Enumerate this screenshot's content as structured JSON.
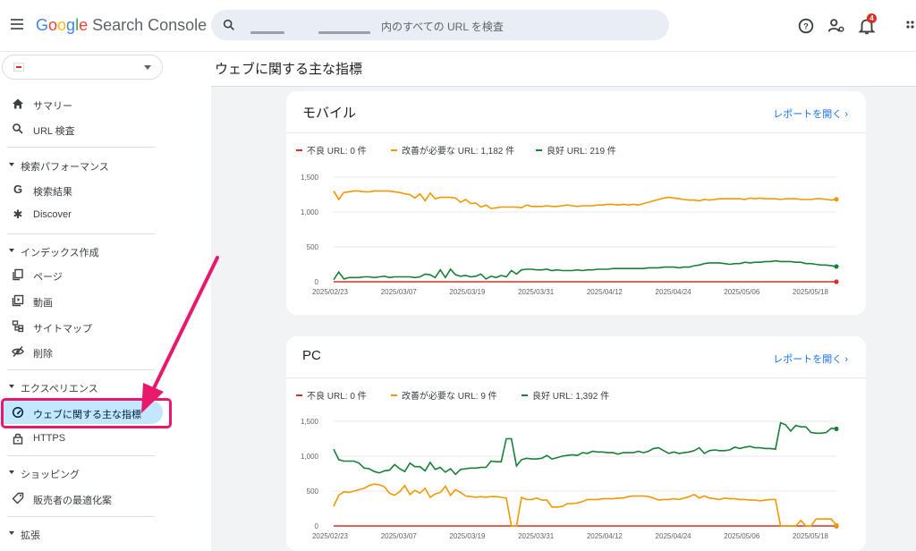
{
  "app": {
    "brand": {
      "g1": "G",
      "g2": "o",
      "g3": "o",
      "g4": "g",
      "g5": "l",
      "g6": "e",
      "product": "Search Console"
    },
    "search_placeholder": "内のすべての URL を検査",
    "notification_count": "4"
  },
  "sidebar": {
    "items": [
      {
        "label": "サマリー",
        "icon": "home-icon"
      },
      {
        "label": "URL 検査",
        "icon": "search-icon"
      },
      {
        "label": "検索パフォーマンス",
        "section": true
      },
      {
        "label": "検索結果",
        "icon": "google-g-icon"
      },
      {
        "label": "Discover",
        "icon": "asterisk-icon"
      },
      {
        "label": "インデックス作成",
        "section": true
      },
      {
        "label": "ページ",
        "icon": "pages-icon"
      },
      {
        "label": "動画",
        "icon": "video-icon"
      },
      {
        "label": "サイトマップ",
        "icon": "sitemap-icon"
      },
      {
        "label": "削除",
        "icon": "removal-icon"
      },
      {
        "label": "エクスペリエンス",
        "section": true
      },
      {
        "label": "ウェブに関する主な指標",
        "icon": "gauge-icon",
        "active": true
      },
      {
        "label": "HTTPS",
        "icon": "lock-icon"
      },
      {
        "label": "ショッピング",
        "section": true
      },
      {
        "label": "販売者の最適化案",
        "icon": "tag-icon"
      },
      {
        "label": "拡張",
        "section": true
      }
    ]
  },
  "main": {
    "title": "ウェブに関する主な指標",
    "report_link": "レポートを開く"
  },
  "colors": {
    "poor": "#d93025",
    "needs": "#f29900",
    "good": "#188038",
    "accent": "#1a73e8",
    "annotation": "#e8196b"
  },
  "chart_data": [
    {
      "type": "line",
      "title": "モバイル",
      "x": [
        "2025/02/23",
        "2025/03/07",
        "2025/03/19",
        "2025/03/31",
        "2025/04/12",
        "2025/04/24",
        "2025/05/06",
        "2025/05/18"
      ],
      "ylim": [
        0,
        1500
      ],
      "yticks": [
        "1,500",
        "1,000",
        "500",
        "0"
      ],
      "series": [
        {
          "name": "不良 URL: 0 件",
          "key": "poor",
          "values": [
            0,
            0,
            0,
            0,
            0,
            0,
            0,
            0,
            0,
            0,
            0,
            0,
            0,
            0,
            0,
            0,
            0,
            0,
            0,
            0,
            0,
            0,
            0,
            0,
            0,
            0,
            0,
            0,
            0,
            0,
            0,
            0,
            0,
            0,
            0,
            0,
            0,
            0,
            0,
            0,
            0,
            0,
            0,
            0,
            0,
            0,
            0,
            0,
            0,
            0,
            0,
            0,
            0,
            0,
            0,
            0,
            0,
            0,
            0,
            0,
            0,
            0,
            0,
            0,
            0,
            0,
            0,
            0,
            0,
            0,
            0,
            0,
            0,
            0,
            0,
            0,
            0,
            0,
            0,
            0,
            0,
            0,
            0,
            0,
            0,
            0,
            0,
            0,
            0,
            0,
            0,
            0,
            0,
            0,
            0,
            0,
            0,
            0,
            0,
            0
          ]
        },
        {
          "name": "改善が必要な URL: 1,182 件",
          "key": "needs",
          "values": [
            1300,
            1180,
            1280,
            1290,
            1300,
            1300,
            1290,
            1290,
            1300,
            1300,
            1300,
            1300,
            1290,
            1280,
            1260,
            1250,
            1200,
            1260,
            1160,
            1270,
            1190,
            1210,
            1210,
            1210,
            1200,
            1140,
            1180,
            1120,
            1130,
            1070,
            1100,
            1050,
            1060,
            1070,
            1070,
            1070,
            1070,
            1060,
            1100,
            1080,
            1080,
            1080,
            1090,
            1080,
            1080,
            1090,
            1100,
            1090,
            1080,
            1090,
            1090,
            1090,
            1100,
            1100,
            1110,
            1110,
            1100,
            1110,
            1100,
            1110,
            1100,
            1120,
            1140,
            1160,
            1180,
            1200,
            1210,
            1200,
            1190,
            1180,
            1170,
            1170,
            1160,
            1180,
            1170,
            1180,
            1190,
            1190,
            1190,
            1190,
            1190,
            1180,
            1200,
            1190,
            1200,
            1190,
            1190,
            1190,
            1180,
            1190,
            1190,
            1190,
            1180,
            1180,
            1180,
            1190,
            1190,
            1180,
            1170,
            1182
          ]
        },
        {
          "name": "良好 URL: 219 件",
          "key": "good",
          "values": [
            30,
            140,
            40,
            60,
            60,
            60,
            70,
            70,
            60,
            70,
            80,
            60,
            70,
            70,
            70,
            70,
            60,
            70,
            110,
            100,
            60,
            170,
            60,
            180,
            100,
            80,
            90,
            70,
            80,
            110,
            40,
            80,
            60,
            90,
            70,
            160,
            110,
            170,
            180,
            180,
            170,
            170,
            180,
            160,
            170,
            160,
            160,
            160,
            170,
            160,
            170,
            170,
            180,
            180,
            180,
            190,
            190,
            190,
            190,
            190,
            190,
            190,
            200,
            200,
            200,
            210,
            210,
            210,
            200,
            210,
            210,
            230,
            240,
            260,
            270,
            270,
            270,
            260,
            250,
            260,
            260,
            280,
            270,
            280,
            280,
            290,
            290,
            300,
            290,
            290,
            290,
            280,
            280,
            260,
            260,
            250,
            240,
            240,
            230,
            219
          ]
        }
      ]
    },
    {
      "type": "line",
      "title": "PC",
      "x": [
        "2025/02/23",
        "2025/03/07",
        "2025/03/19",
        "2025/03/31",
        "2025/04/12",
        "2025/04/24",
        "2025/05/06",
        "2025/05/18"
      ],
      "ylim": [
        0,
        1500
      ],
      "yticks": [
        "1,500",
        "1,000",
        "500",
        "0"
      ],
      "series": [
        {
          "name": "不良 URL: 0 件",
          "key": "poor",
          "values": [
            0,
            0,
            0,
            0,
            0,
            0,
            0,
            0,
            0,
            0,
            0,
            0,
            0,
            0,
            0,
            0,
            0,
            0,
            0,
            0,
            0,
            0,
            0,
            0,
            0,
            0,
            0,
            0,
            0,
            0,
            0,
            0,
            0,
            0,
            0,
            0,
            0,
            0,
            0,
            0,
            0,
            0,
            0,
            0,
            0,
            0,
            0,
            0,
            0,
            0,
            0,
            0,
            0,
            0,
            0,
            0,
            0,
            0,
            0,
            0,
            0,
            0,
            0,
            0,
            0,
            0,
            0,
            0,
            0,
            0,
            0,
            0,
            0,
            0,
            0,
            0,
            0,
            0,
            0,
            0,
            0,
            0,
            0,
            0,
            0,
            0,
            0,
            0,
            0,
            0,
            0,
            0,
            0,
            0,
            0,
            0,
            0,
            0,
            0,
            0
          ]
        },
        {
          "name": "改善が必要な URL: 9 件",
          "key": "needs",
          "values": [
            280,
            440,
            490,
            480,
            500,
            520,
            540,
            580,
            600,
            590,
            560,
            470,
            440,
            490,
            580,
            450,
            510,
            470,
            540,
            410,
            460,
            480,
            570,
            440,
            520,
            480,
            430,
            420,
            410,
            420,
            410,
            420,
            420,
            410,
            400,
            0,
            0,
            410,
            380,
            380,
            400,
            370,
            370,
            270,
            270,
            280,
            320,
            320,
            330,
            350,
            380,
            380,
            380,
            390,
            390,
            390,
            400,
            400,
            420,
            430,
            430,
            430,
            420,
            400,
            370,
            380,
            380,
            390,
            380,
            400,
            420,
            450,
            400,
            430,
            400,
            390,
            380,
            400,
            390,
            390,
            380,
            380,
            370,
            370,
            360,
            370,
            380,
            380,
            0,
            0,
            0,
            0,
            80,
            0,
            0,
            100,
            100,
            100,
            100,
            9
          ]
        },
        {
          "name": "良好 URL: 1,392 件",
          "key": "good",
          "values": [
            1100,
            950,
            930,
            930,
            930,
            900,
            830,
            820,
            780,
            760,
            790,
            800,
            880,
            820,
            780,
            900,
            850,
            850,
            790,
            910,
            810,
            840,
            770,
            820,
            740,
            810,
            820,
            830,
            830,
            840,
            840,
            930,
            920,
            920,
            1250,
            1250,
            860,
            950,
            970,
            960,
            960,
            970,
            1010,
            960,
            980,
            1000,
            1010,
            1020,
            1010,
            1050,
            1040,
            1070,
            1060,
            1060,
            1050,
            1050,
            1030,
            1050,
            1050,
            1050,
            1070,
            1050,
            1070,
            1110,
            1120,
            1080,
            1040,
            1060,
            1040,
            1050,
            1060,
            1080,
            1120,
            1040,
            1080,
            1090,
            1080,
            1080,
            1090,
            1130,
            1110,
            1130,
            1140,
            1120,
            1120,
            1110,
            1110,
            1100,
            1480,
            1450,
            1360,
            1440,
            1420,
            1420,
            1340,
            1330,
            1330,
            1340,
            1400,
            1392
          ]
        }
      ]
    }
  ]
}
